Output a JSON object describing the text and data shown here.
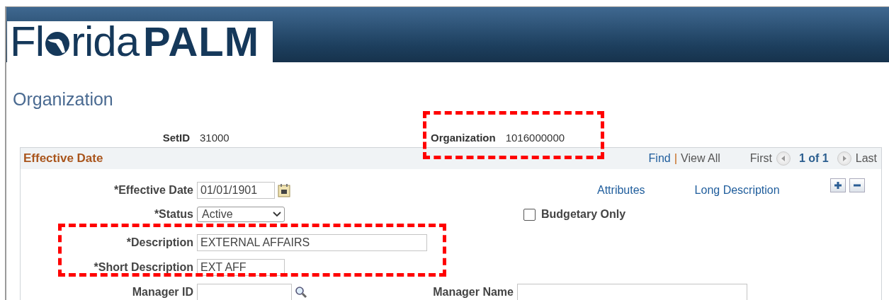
{
  "logo": {
    "prefix": "Fl",
    "suffix": "rida",
    "bold": "PALM"
  },
  "page_title": "Organization",
  "keys": [
    {
      "label": "SetID",
      "value": "31000"
    },
    {
      "label": "Organization",
      "value": "1016000000"
    }
  ],
  "panel": {
    "title": "Effective Date",
    "find": "Find",
    "separator": "|",
    "view_all": "View All",
    "first": "First",
    "count": "1 of 1",
    "last": "Last"
  },
  "links": [
    "Attributes",
    "Long Description"
  ],
  "fields": {
    "effective_date": {
      "label": "*Effective Date",
      "value": "01/01/1901"
    },
    "status": {
      "label": "*Status",
      "value": "Active"
    },
    "budgetary_only": {
      "label": "Budgetary Only",
      "checked": false
    },
    "description": {
      "label": "*Description",
      "value": "EXTERNAL AFFAIRS"
    },
    "short_description": {
      "label": "*Short Description",
      "value": "EXT AFF"
    },
    "manager_id": {
      "label": "Manager ID"
    },
    "manager_name": {
      "label": "Manager Name"
    }
  },
  "annotations": [
    {
      "kind": "dashed-box"
    },
    {
      "kind": "dashed-box"
    }
  ]
}
